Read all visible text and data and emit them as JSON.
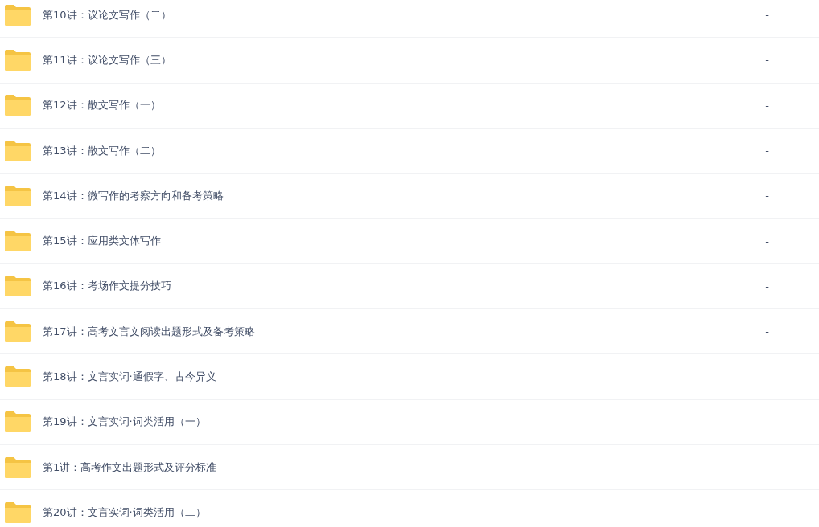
{
  "rows": [
    {
      "name": "第10讲：议论文写作（二）",
      "size": "-"
    },
    {
      "name": "第11讲：议论文写作（三）",
      "size": "-"
    },
    {
      "name": "第12讲：散文写作（一）",
      "size": "-"
    },
    {
      "name": "第13讲：散文写作（二）",
      "size": "-"
    },
    {
      "name": "第14讲：微写作的考察方向和备考策略",
      "size": "-"
    },
    {
      "name": "第15讲：应用类文体写作",
      "size": "-"
    },
    {
      "name": "第16讲：考场作文提分技巧",
      "size": "-"
    },
    {
      "name": "第17讲：高考文言文阅读出题形式及备考策略",
      "size": "-"
    },
    {
      "name": "第18讲：文言实词·通假字、古今异义",
      "size": "-"
    },
    {
      "name": "第19讲：文言实词·词类活用（一）",
      "size": "-"
    },
    {
      "name": "第1讲：高考作文出题形式及评分标准",
      "size": "-"
    },
    {
      "name": "第20讲：文言实词·词类活用（二）",
      "size": "-"
    }
  ]
}
